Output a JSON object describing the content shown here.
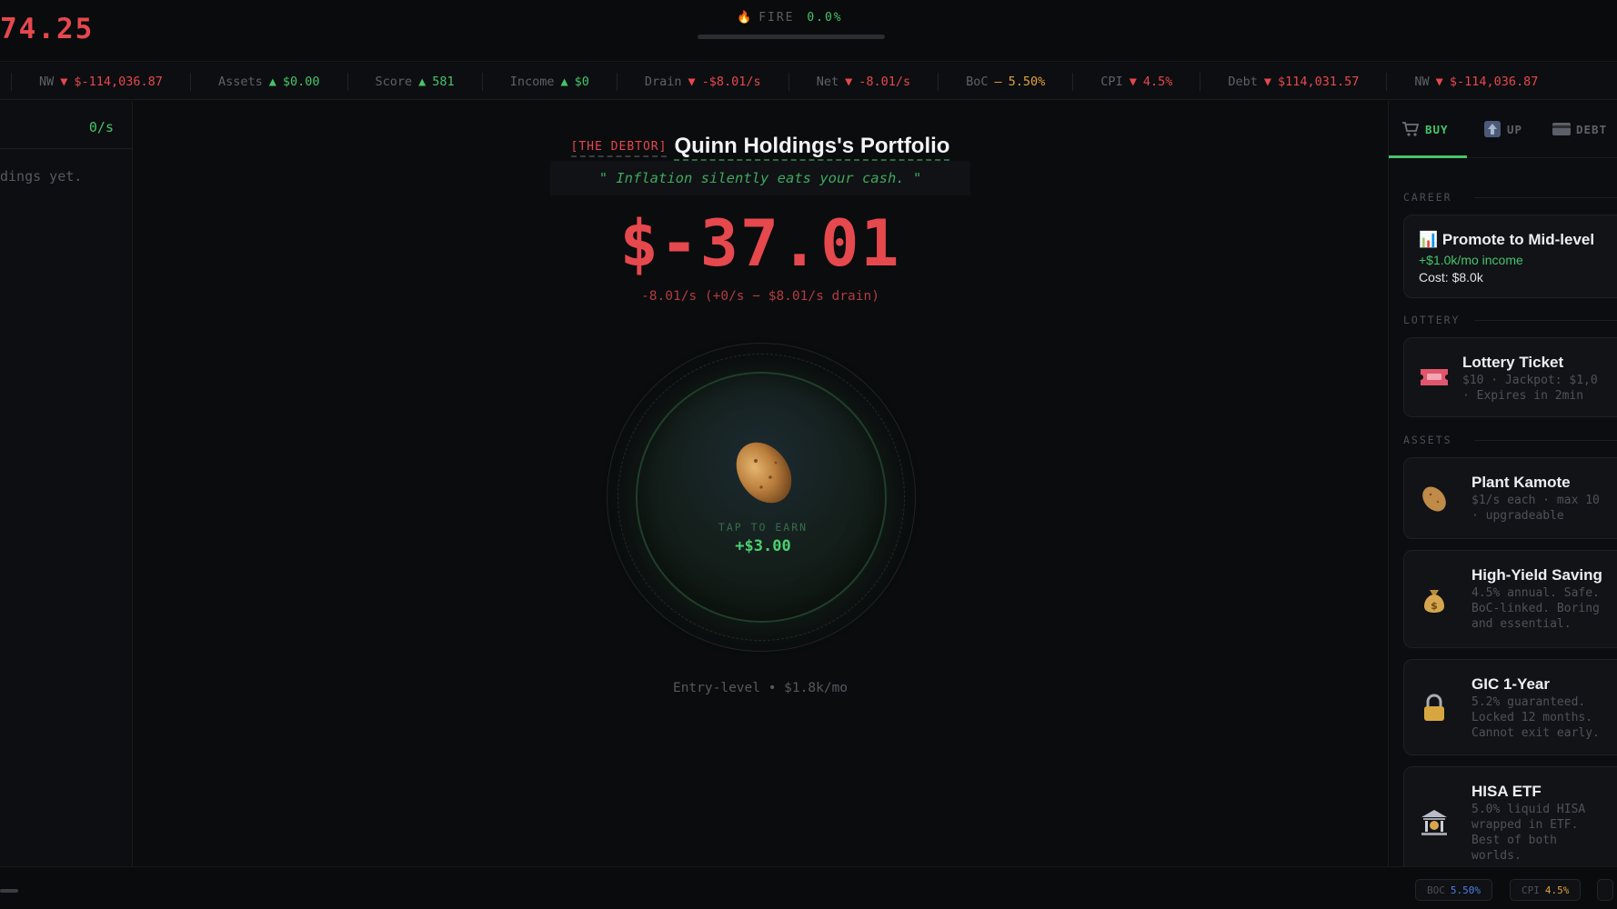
{
  "header": {
    "cash": "74.25",
    "fire_label": "FIRE",
    "fire_value": "0.0%",
    "fire_progress": 0.0
  },
  "ticker": [
    {
      "label": "NW",
      "dir": "▼",
      "value": "$-114,036.87",
      "color": "red"
    },
    {
      "label": "Assets",
      "dir": "▲",
      "value": "$0.00",
      "color": "green"
    },
    {
      "label": "Score",
      "dir": "▲",
      "value": "581",
      "color": "green"
    },
    {
      "label": "Income",
      "dir": "▲",
      "value": "$0",
      "color": "green"
    },
    {
      "label": "Drain",
      "dir": "▼",
      "value": "-$8.01/s",
      "color": "red"
    },
    {
      "label": "Net",
      "dir": "▼",
      "value": "-8.01/s",
      "color": "red"
    },
    {
      "label": "BoC",
      "dir": "–",
      "value": "5.50%",
      "color": "amber"
    },
    {
      "label": "CPI",
      "dir": "▼",
      "value": "4.5%",
      "color": "red"
    },
    {
      "label": "Debt",
      "dir": "▼",
      "value": "$114,031.57",
      "color": "red"
    },
    {
      "label": "NW",
      "dir": "▼",
      "value": "$-114,036.87",
      "color": "red"
    }
  ],
  "left": {
    "rate": "0/s",
    "empty": "dings yet."
  },
  "center": {
    "tag": "[THE DEBTOR]",
    "portfolio_name": "Quinn Holdings's Portfolio",
    "quote": "\" Inflation silently eats your cash. \"",
    "balance": "$-37.01",
    "rate_line": "-8.01/s (+0/s − $8.01/s drain)",
    "tap_label": "TAP TO EARN",
    "tap_amount": "+$3.00",
    "job": "Entry-level • $1.8k/mo"
  },
  "shop": {
    "tabs": [
      {
        "label": "BUY",
        "icon": "cart-icon",
        "active": true
      },
      {
        "label": "UP",
        "icon": "upgrade-icon",
        "active": false
      },
      {
        "label": "DEBT",
        "icon": "credit-card-icon",
        "active": false
      }
    ],
    "sections": {
      "career": "CAREER",
      "lottery": "LOTTERY",
      "assets": "ASSETS"
    },
    "career_card": {
      "title": "📊 Promote to Mid-level",
      "income": "+$1.0k/mo income",
      "cost": "Cost: $8.0k"
    },
    "lottery_card": {
      "title": "Lottery Ticket",
      "desc": "$10 · Jackpot: $1,0\n· Expires in 2min"
    },
    "asset_cards": [
      {
        "title": "Plant Kamote",
        "icon": "potato-icon",
        "desc": "$1/s each · max 10\n· upgradeable"
      },
      {
        "title": "High-Yield Saving",
        "icon": "money-bag-icon",
        "desc": "4.5% annual. Safe.\nBoC-linked. Boring\nand essential."
      },
      {
        "title": "GIC 1-Year",
        "icon": "lock-icon",
        "desc": "5.2% guaranteed.\nLocked 12 months.\nCannot exit early."
      },
      {
        "title": "HISA ETF",
        "icon": "bank-icon",
        "desc": "5.0% liquid HISA\nwrapped in ETF.\nBest of both\nworlds."
      }
    ]
  },
  "footer": {
    "boc_label": "BOC",
    "boc_value": "5.50%",
    "cpi_label": "CPI",
    "cpi_value": "4.5%"
  },
  "colors": {
    "red": "#e5484d",
    "green": "#46c46a",
    "amber": "#e0a33a",
    "background": "#0b0c0e",
    "boc_blue": "#4f7ee8"
  }
}
